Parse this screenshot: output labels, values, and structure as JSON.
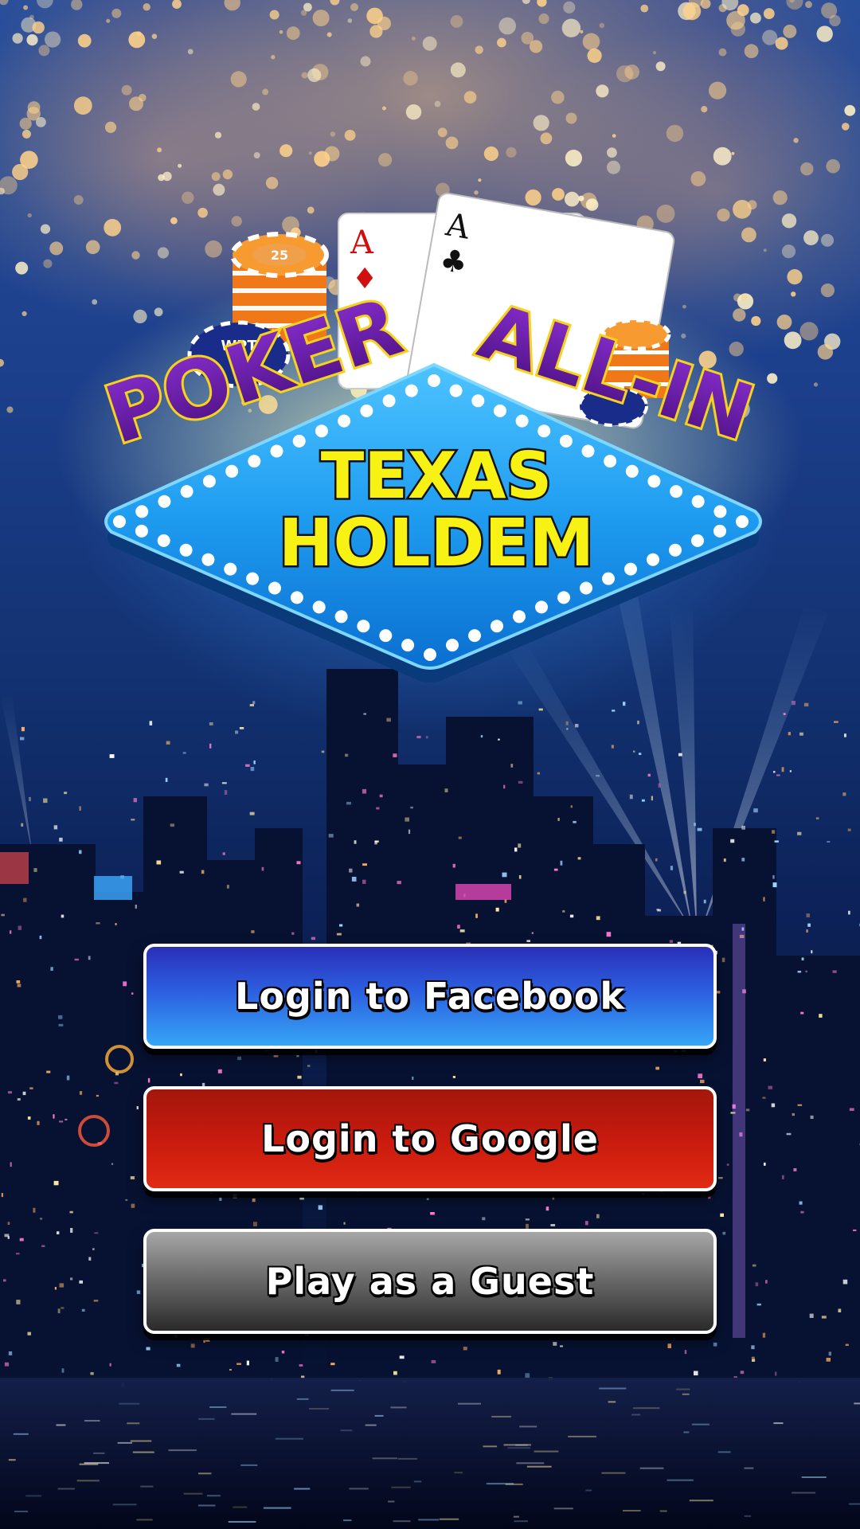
{
  "logo": {
    "word_left": "POKER",
    "word_right": "ALL-IN",
    "sign_line1": "TEXAS",
    "sign_line2": "HOLDEM",
    "card1_rank": "A",
    "card1_suit": "♦",
    "card2_rank": "A",
    "card2_suit": "♣",
    "chip_label": "25",
    "blue_chip_text": "WPT"
  },
  "buttons": {
    "facebook": "Login to Facebook",
    "google": "Login to Google",
    "guest": "Play as a Guest"
  },
  "colors": {
    "sign_blue": "#1e9cf0",
    "title_yellow": "#f7f214",
    "word_purple": "#5a1690",
    "facebook_blue": "#2c5fe0",
    "google_red": "#c81a0e",
    "guest_gray": "#6d6d6d"
  }
}
